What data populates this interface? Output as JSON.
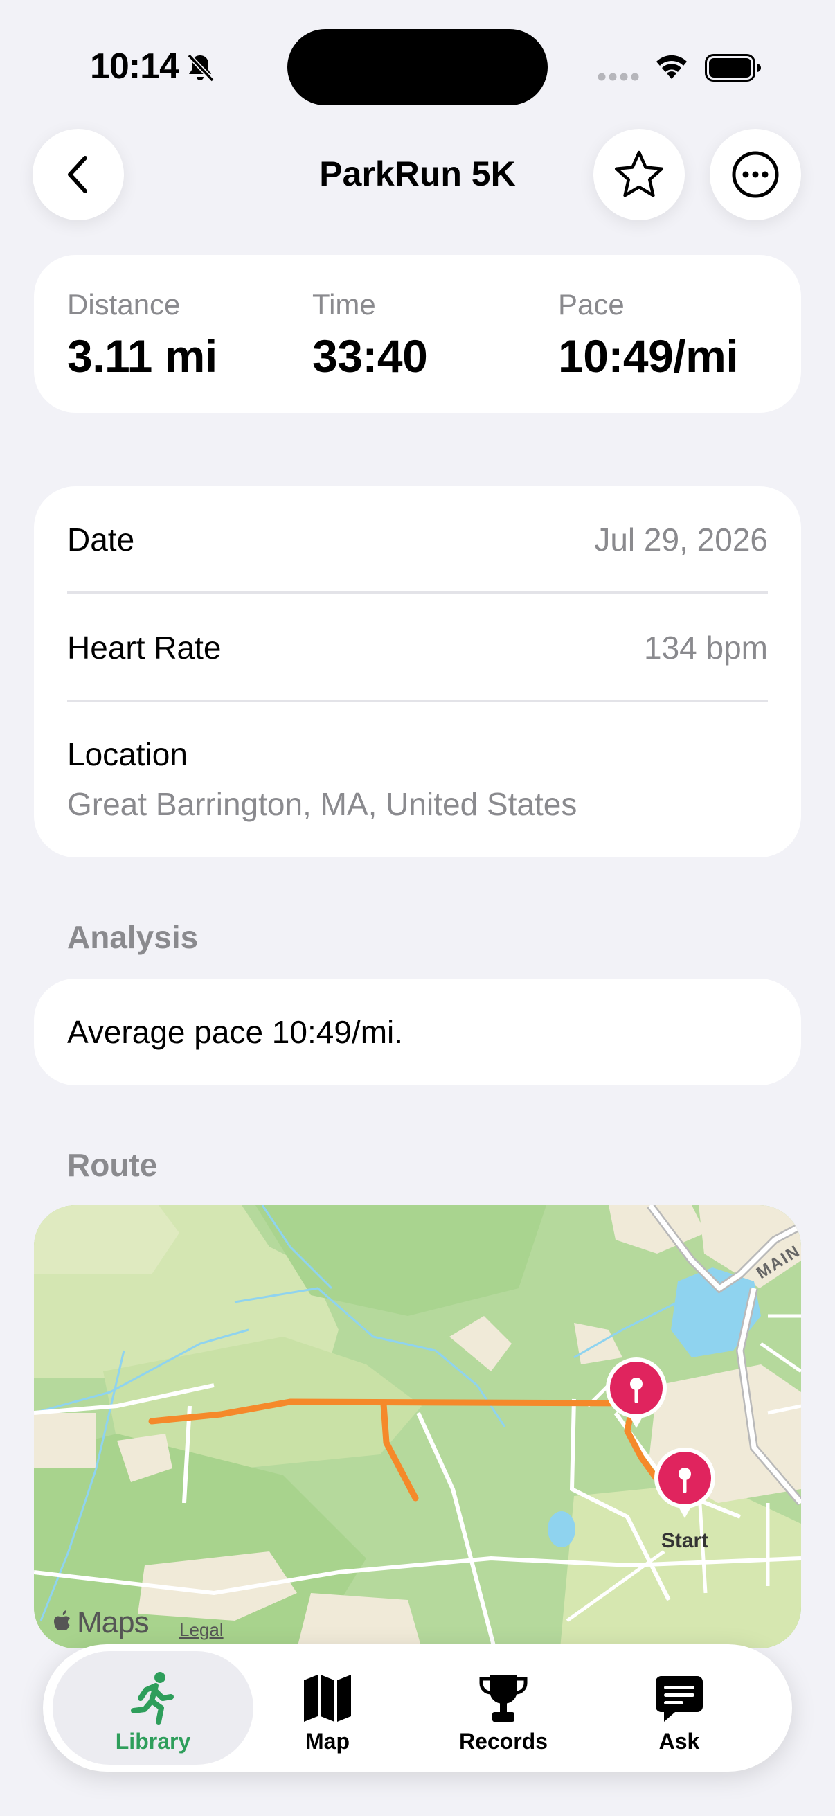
{
  "status_bar": {
    "time": "10:14"
  },
  "nav": {
    "title": "ParkRun 5K"
  },
  "stats": [
    {
      "label": "Distance",
      "value": "3.11 mi"
    },
    {
      "label": "Time",
      "value": "33:40"
    },
    {
      "label": "Pace",
      "value": "10:49/mi"
    }
  ],
  "details": {
    "date_label": "Date",
    "date_value": "Jul 29, 2026",
    "hr_label": "Heart Rate",
    "hr_value": "134 bpm",
    "location_label": "Location",
    "location_value": "Great Barrington, MA, United States"
  },
  "analysis": {
    "header": "Analysis",
    "text": "Average pace 10:49/mi."
  },
  "route": {
    "header": "Route",
    "start_label": "Start",
    "street_label": "MAIN",
    "maps_brand": "Maps",
    "legal_label": "Legal",
    "route_color": "#f5892a",
    "pin_color": "#e0245e"
  },
  "tabs": [
    {
      "label": "Library",
      "icon": "runner-icon",
      "active": true
    },
    {
      "label": "Map",
      "icon": "map-icon",
      "active": false
    },
    {
      "label": "Records",
      "icon": "trophy-icon",
      "active": false
    },
    {
      "label": "Ask",
      "icon": "chat-bubble-icon",
      "active": false
    }
  ],
  "colors": {
    "accent": "#2e9e5b",
    "background": "#f2f2f7",
    "secondary_text": "#8a8a8e"
  }
}
